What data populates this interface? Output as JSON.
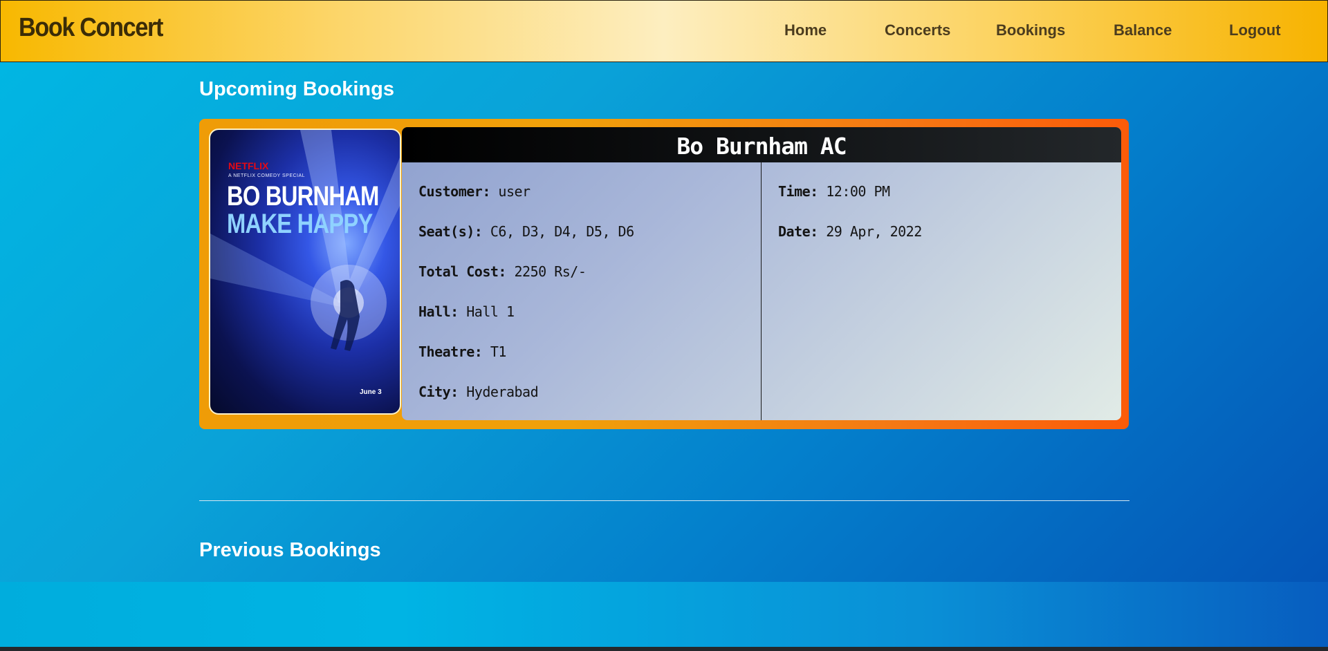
{
  "app": {
    "brand": "Book Concert"
  },
  "nav": {
    "items": [
      "Home",
      "Concerts",
      "Bookings",
      "Balance",
      "Logout"
    ]
  },
  "sections": {
    "upcoming_title": "Upcoming Bookings",
    "previous_title": "Previous Bookings"
  },
  "booking": {
    "title": "Bo Burnham AC",
    "poster": {
      "brand": "NETFLIX",
      "subtitle": "A NETFLIX COMEDY SPECIAL",
      "line1": "BO BURNHAM",
      "line2": "MAKE HAPPY",
      "date": "June 3"
    },
    "left_fields": [
      {
        "label": "Customer:",
        "value": "user"
      },
      {
        "label": "Seat(s):",
        "value": "C6, D3, D4, D5, D6"
      },
      {
        "label": "Total Cost:",
        "value": "2250 Rs/-"
      },
      {
        "label": "Hall:",
        "value": "Hall 1"
      },
      {
        "label": "Theatre:",
        "value": "T1"
      },
      {
        "label": "City:",
        "value": "Hyderabad"
      }
    ],
    "right_fields": [
      {
        "label": "Time:",
        "value": "12:00 PM"
      },
      {
        "label": "Date:",
        "value": "29 Apr, 2022"
      }
    ]
  },
  "colors": {
    "navbar_accent": "#f8b800",
    "ticket_accent": "#fb5b09",
    "page_bg": "#0a8fd6"
  }
}
